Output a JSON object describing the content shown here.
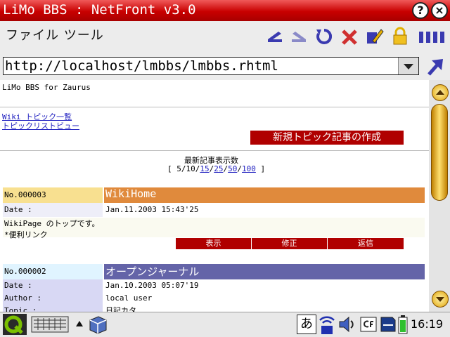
{
  "window": {
    "title": "LiMo BBS : NetFront v3.0"
  },
  "menu": {
    "label": "ファイル ツール"
  },
  "address": {
    "url": "http://localhost/lmbbs/lmbbs.rhtml"
  },
  "page": {
    "header": "LiMo BBS for Zaurus",
    "links": [
      "Wiki トピック一覧",
      "トピックリストビュー"
    ],
    "new_topic_button": "新規トピック記事の作成",
    "latest_count": {
      "label": "最新記事表示数",
      "open": "[",
      "current": "5/10/",
      "options": [
        "15",
        "25",
        "50",
        "100"
      ],
      "close": "]"
    },
    "posts": [
      {
        "no": "No.000003",
        "title": "WikiHome",
        "date_label": "Date :",
        "date": "Jan.11.2003 15:43'25",
        "body": [
          "WikiPage のトップです。",
          "*便利リンク"
        ],
        "actions": [
          "表示",
          "修正",
          "返信"
        ]
      },
      {
        "no": "No.000002",
        "title": "オープンジャーナル",
        "date_label": "Date :",
        "date": "Jan.10.2003 05:07'19",
        "author_label": "Author :",
        "author": "local user",
        "topic_label": "Topic :",
        "topic": "日記カタ"
      }
    ]
  },
  "taskbar": {
    "ime": "あ",
    "clock": "16:19"
  },
  "colors": {
    "titlebar": "#c80000",
    "post1_title_bg": "#e08a3c",
    "post1_no_bg": "#f8e090",
    "post2_title_bg": "#6464a8",
    "post2_no_bg": "#e0f4ff",
    "label_bg": "#d8d8f4",
    "button_red": "#b00000"
  }
}
